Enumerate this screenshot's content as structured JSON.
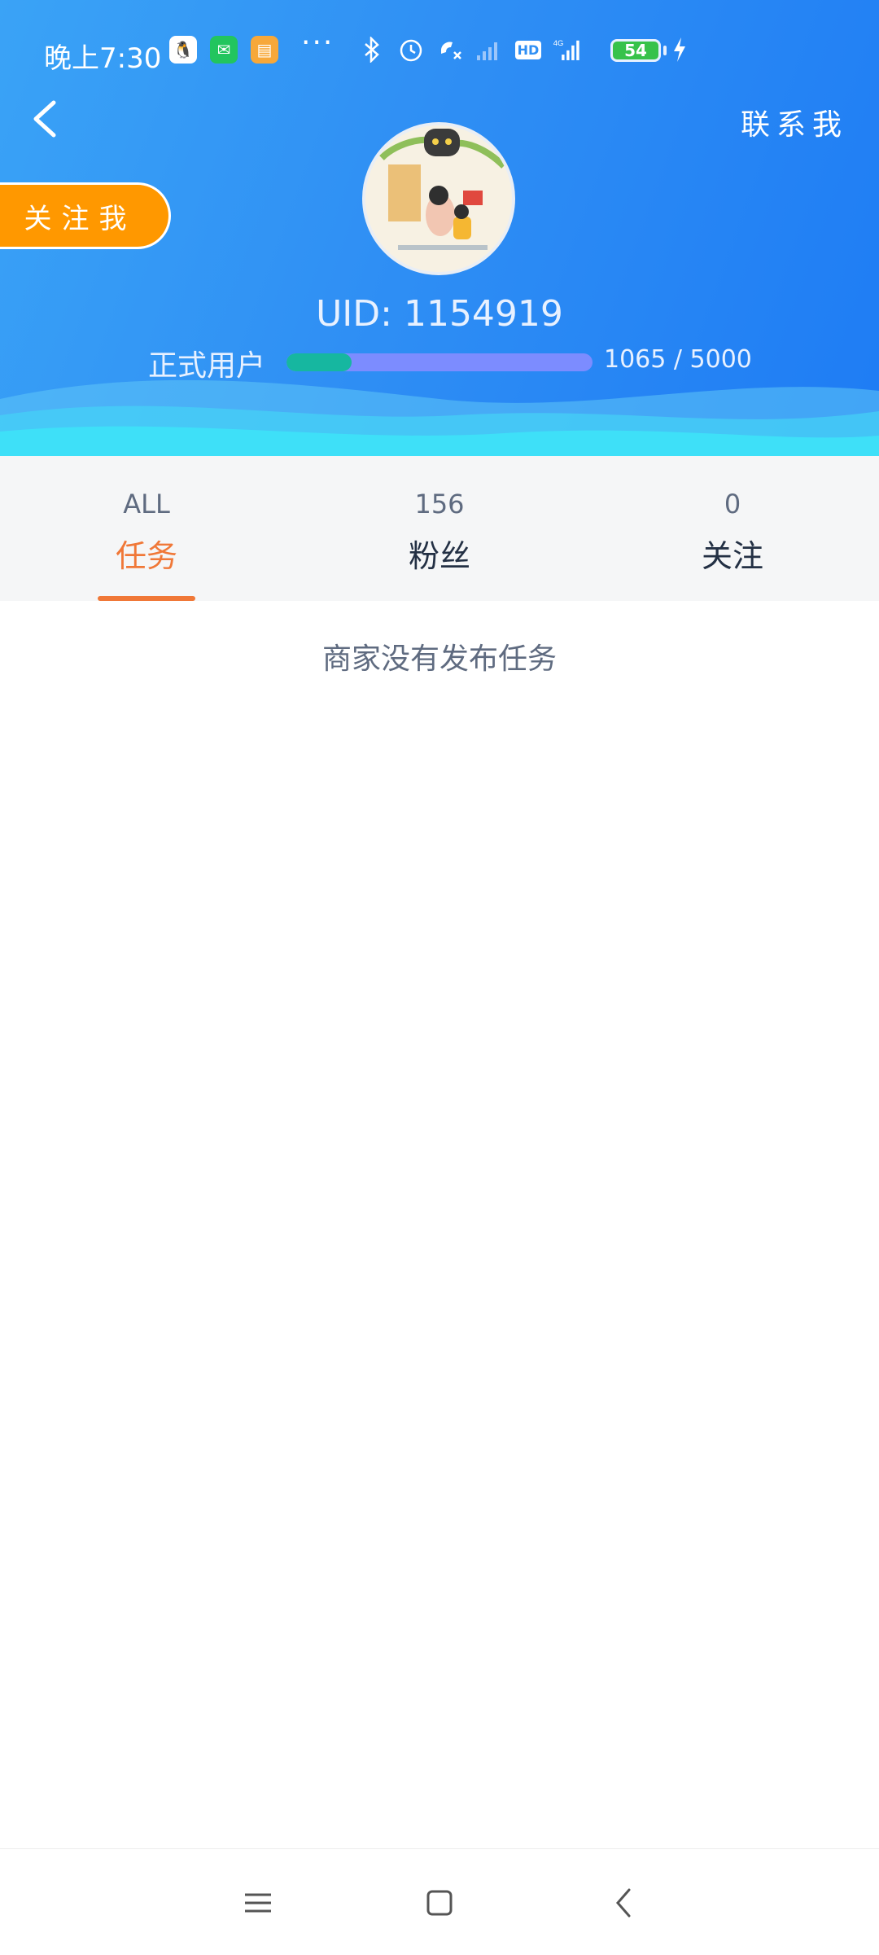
{
  "status_bar": {
    "time": "晚上7:30",
    "battery": "54",
    "network": "4G",
    "hd": "HD",
    "more": "···"
  },
  "header": {
    "contact_label": "联系我",
    "follow_label": "关注我",
    "uid_text": "UID: 1154919",
    "user_type": "正式用户",
    "progress": {
      "current": 1065,
      "max": 5000,
      "text": "1065 / 5000",
      "fraction": 0.213
    }
  },
  "tabs": [
    {
      "count": "ALL",
      "label": "任务",
      "active": true
    },
    {
      "count": "156",
      "label": "粉丝",
      "active": false
    },
    {
      "count": "0",
      "label": "关注",
      "active": false
    }
  ],
  "empty_message": "商家没有发布任务",
  "colors": {
    "header_blue": "#2f8ff4",
    "accent_orange": "#f07838",
    "follow_orange": "#ff9800",
    "progress_teal": "#16b7a0",
    "progress_track": "#7c8cff"
  }
}
